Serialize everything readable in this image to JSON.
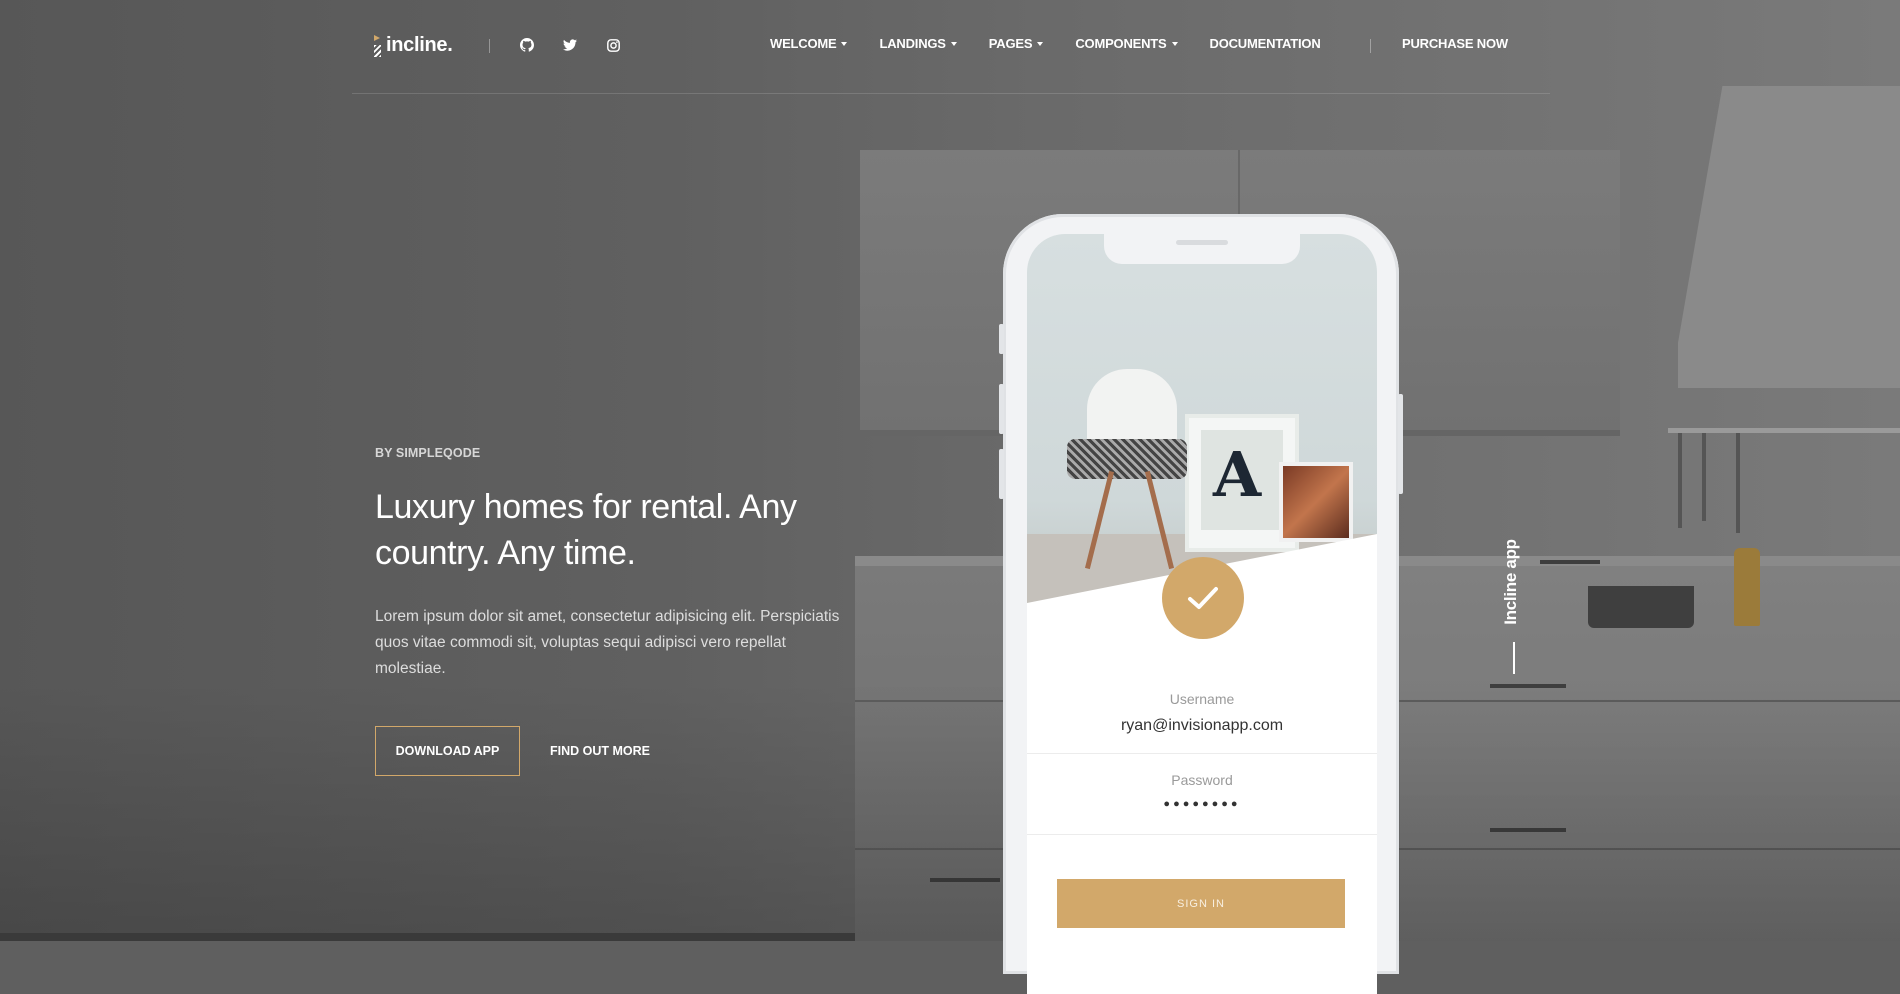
{
  "brand": {
    "name": "incline.",
    "accent": "#d2a86a"
  },
  "social": [
    "github-icon",
    "twitter-icon",
    "instagram-icon"
  ],
  "nav": {
    "items": [
      {
        "label": "WELCOME",
        "dropdown": true
      },
      {
        "label": "LANDINGS",
        "dropdown": true
      },
      {
        "label": "PAGES",
        "dropdown": true
      },
      {
        "label": "COMPONENTS",
        "dropdown": true
      },
      {
        "label": "DOCUMENTATION",
        "dropdown": false
      }
    ],
    "purchase": "PURCHASE NOW"
  },
  "hero": {
    "eyebrow": "BY SIMPLEQODE",
    "title": "Luxury homes for rental. Any country. Any time.",
    "description": "Lorem ipsum dolor sit amet, consectetur adipisicing elit. Perspiciatis quos vitae commodi sit, voluptas sequi adipisci vero repellat molestiae.",
    "primary_button": "DOWNLOAD APP",
    "secondary_button": "FIND OUT MORE"
  },
  "phone": {
    "username_label": "Username",
    "username_value": "ryan@invisionapp.com",
    "password_label": "Password",
    "password_value": "●●●●●●●●",
    "signin_label": "SIGN IN",
    "frame_letter": "A"
  },
  "side_label": "Incline app"
}
